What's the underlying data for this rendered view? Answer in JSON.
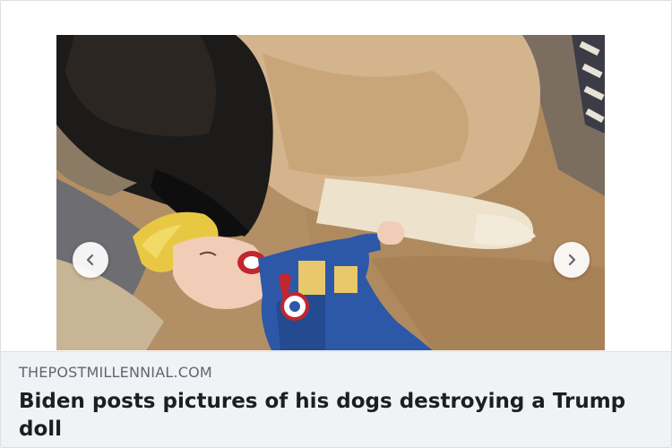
{
  "media": {
    "image_alt": "",
    "prev_icon": "chevron-left-icon",
    "next_icon": "chevron-right-icon"
  },
  "link": {
    "domain": "THEPOSTMILLENNIAL.COM",
    "title": "Biden posts pictures of his dogs destroying a Trump doll"
  },
  "colors": {
    "footer_bg": "#f0f2f5",
    "domain_text": "#606770",
    "title_text": "#1c1e21"
  }
}
